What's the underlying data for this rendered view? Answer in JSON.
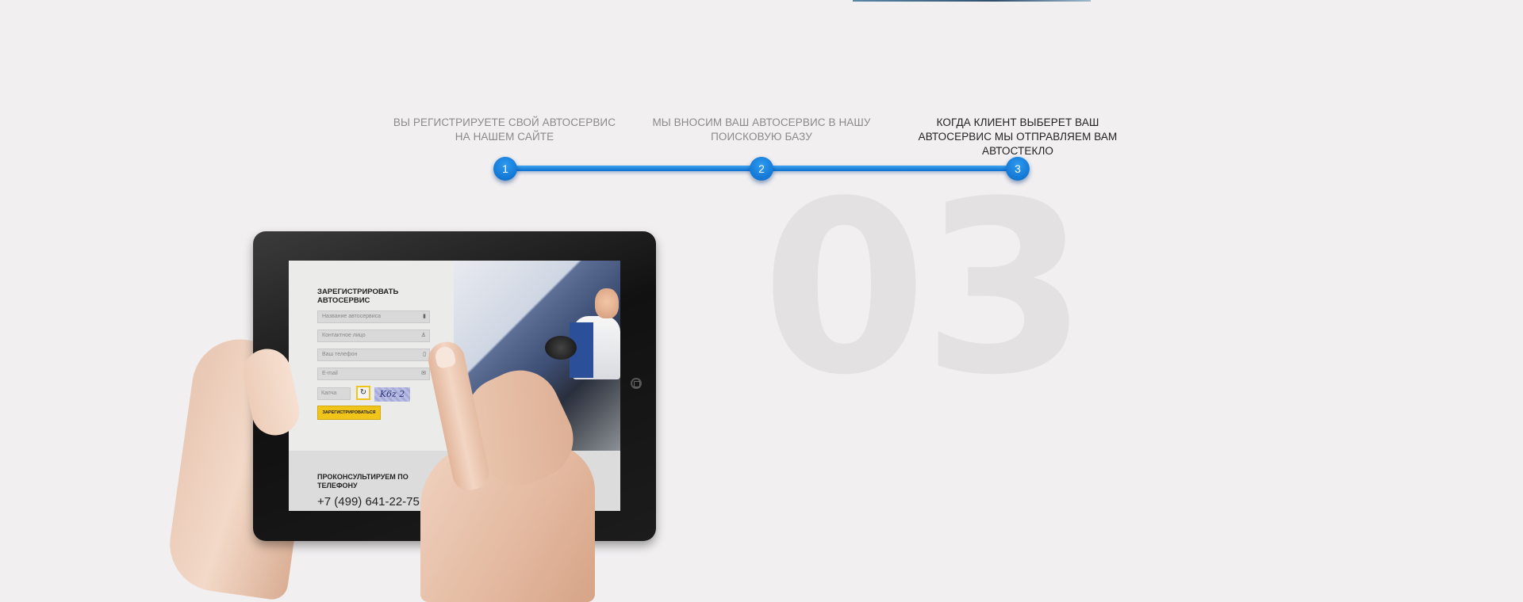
{
  "steps": [
    {
      "number": "1",
      "text": "ВЫ РЕГИСТРИРУЕТЕ СВОЙ АВТОСЕРВИС НА НАШЕМ САЙТЕ"
    },
    {
      "number": "2",
      "text": "МЫ ВНОСИМ ВАШ АВТОСЕРВИС В НАШУ ПОИСКОВУЮ БАЗУ"
    },
    {
      "number": "3",
      "text": "КОГДА КЛИЕНТ ВЫБЕРЕТ ВАШ АВТОСЕРВИС МЫ ОТПРАВЛЯЕМ ВАМ АВТОСТЕКЛО"
    }
  ],
  "active_step": 3,
  "big_number": "03",
  "tablet": {
    "form_title": "ЗАРЕГИСТРИРОВАТЬ АВТОСЕРВИС",
    "fields": [
      {
        "placeholder": "Название автосервиса",
        "icon": "building-icon"
      },
      {
        "placeholder": "Контактное лицо",
        "icon": "user-icon"
      },
      {
        "placeholder": "Ваш телефон",
        "icon": "phone-icon"
      },
      {
        "placeholder": "E-mail",
        "icon": "mail-icon"
      }
    ],
    "captcha_placeholder": "Капча",
    "captcha_text": "K6z 2",
    "submit_label": "ЗАРЕГИСТРИРОВАТЬСЯ",
    "footer_title": "ПРОКОНСУЛЬТИРУЕМ ПО ТЕЛЕФОНУ",
    "phone": "+7 (499) 641-22-75"
  },
  "colors": {
    "background": "#f1eff0",
    "accent_blue": "#0a6fd0",
    "button_yellow": "#f0c419",
    "big_number": "#e3e1e2"
  }
}
